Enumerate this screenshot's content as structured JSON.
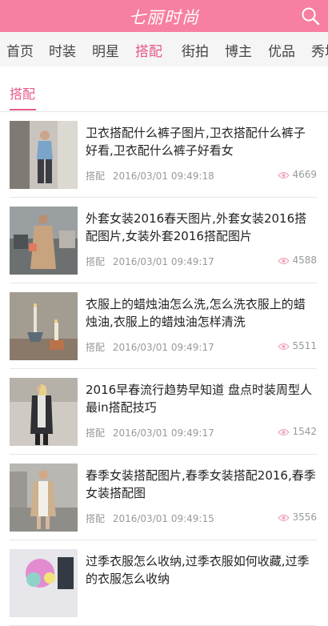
{
  "header": {
    "logo_text": "七丽时尚"
  },
  "nav": {
    "items": [
      {
        "label": "首页"
      },
      {
        "label": "时装"
      },
      {
        "label": "明星"
      },
      {
        "label": "搭配"
      },
      {
        "label": "街拍"
      },
      {
        "label": "博主"
      },
      {
        "label": "优品"
      },
      {
        "label": "秀场"
      }
    ],
    "active_index": 3
  },
  "section": {
    "tab_label": "搭配"
  },
  "articles": [
    {
      "title": "卫衣搭配什么裤子图片,卫衣搭配什么裤子好看,卫衣配什么裤子好看女",
      "category": "搭配",
      "datetime": "2016/03/01 09:49:18",
      "views": "4669"
    },
    {
      "title": "外套女装2016春天图片,外套女装2016搭配图片,女装外套2016搭配图片",
      "category": "搭配",
      "datetime": "2016/03/01 09:49:17",
      "views": "4588"
    },
    {
      "title": "衣服上的蜡烛油怎么洗,怎么洗衣服上的蜡烛油,衣服上的蜡烛油怎样清洗",
      "category": "搭配",
      "datetime": "2016/03/01 09:49:17",
      "views": "5511"
    },
    {
      "title": "2016早春流行趋势早知道 盘点时装周型人最in搭配技巧",
      "category": "搭配",
      "datetime": "2016/03/01 09:49:17",
      "views": "1542"
    },
    {
      "title": "春季女装搭配图片,春季女装搭配2016,春季女装搭配图",
      "category": "搭配",
      "datetime": "2016/03/01 09:49:15",
      "views": "3556"
    },
    {
      "title": "过季衣服怎么收纳,过季衣服如何收藏,过季的衣服怎么收纳",
      "category": "",
      "datetime": "",
      "views": ""
    }
  ],
  "colors": {
    "brand_pink": "#f77fa1",
    "accent_pink": "#e8598a"
  },
  "icons": {
    "search": "search-icon",
    "views": "eye-icon"
  }
}
